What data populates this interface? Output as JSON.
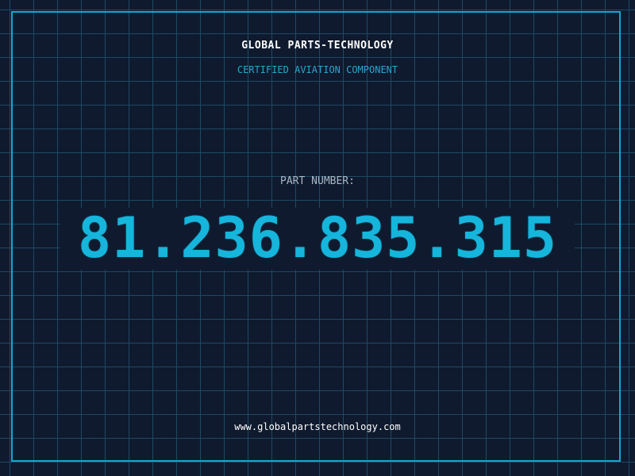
{
  "header": {
    "company_name": "GLOBAL PARTS-TECHNOLOGY",
    "tagline": "CERTIFIED AVIATION COMPONENT"
  },
  "part": {
    "label": "PART NUMBER:",
    "number": "81.236.835.315"
  },
  "footer": {
    "website": "www.globalpartstechnology.com"
  },
  "colors": {
    "background": "#0f1a2e",
    "grid": "#1c4a63",
    "frame": "#1aa3cc",
    "accent": "#16b5dc",
    "tagline": "#2aa5cf",
    "label": "#a9b8c8",
    "text": "#ffffff"
  }
}
